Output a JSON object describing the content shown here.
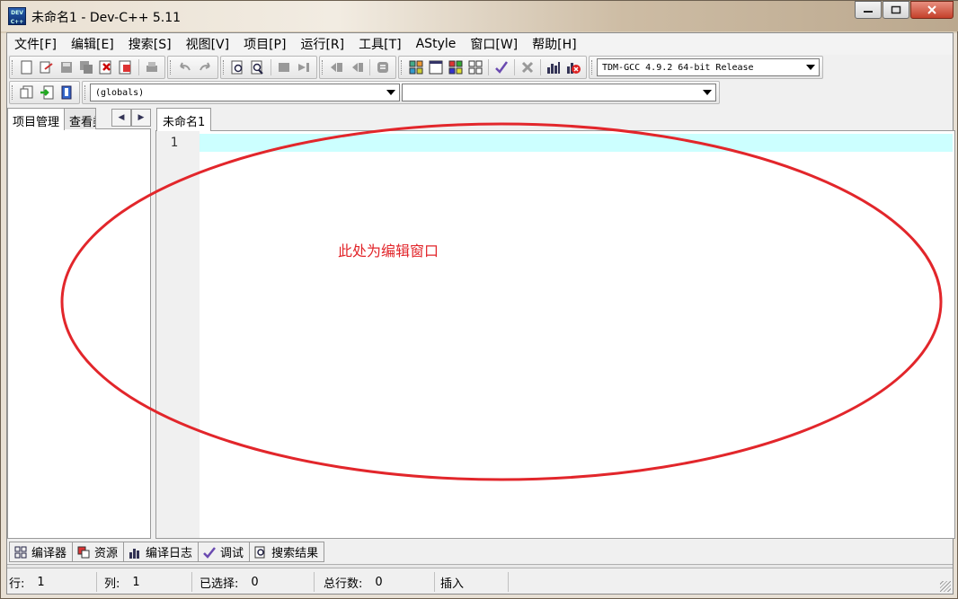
{
  "window": {
    "title": "未命名1 - Dev-C++ 5.11",
    "icon_label_top": "DEV",
    "icon_label_bottom": "C++"
  },
  "menu": [
    {
      "label": "文件[F]"
    },
    {
      "label": "编辑[E]"
    },
    {
      "label": "搜索[S]"
    },
    {
      "label": "视图[V]"
    },
    {
      "label": "项目[P]"
    },
    {
      "label": "运行[R]"
    },
    {
      "label": "工具[T]"
    },
    {
      "label": "AStyle"
    },
    {
      "label": "窗口[W]"
    },
    {
      "label": "帮助[H]"
    }
  ],
  "toolbar": {
    "compiler_select": "TDM-GCC 4.9.2 64-bit Release",
    "scope_select": "(globals)",
    "function_select": ""
  },
  "left_panel": {
    "tabs": [
      "项目管理",
      "查看类"
    ],
    "active_tab": "项目管理"
  },
  "editor": {
    "tab_label": "未命名1",
    "line_numbers": [
      "1"
    ],
    "current_line_color": "#ccffff"
  },
  "annotation": {
    "text": "此处为编辑窗口",
    "color": "#e2262b"
  },
  "bottom_tabs": [
    {
      "label": "编译器",
      "icon": "grid-icon"
    },
    {
      "label": "资源",
      "icon": "resources-icon"
    },
    {
      "label": "编译日志",
      "icon": "bar-chart-icon"
    },
    {
      "label": "调试",
      "icon": "check-icon"
    },
    {
      "label": "搜索结果",
      "icon": "search-doc-icon"
    }
  ],
  "status": {
    "row_label": "行:",
    "row_value": "1",
    "col_label": "列:",
    "col_value": "1",
    "selected_label": "已选择:",
    "selected_value": "0",
    "total_label": "总行数:",
    "total_value": "0",
    "mode": "插入"
  }
}
